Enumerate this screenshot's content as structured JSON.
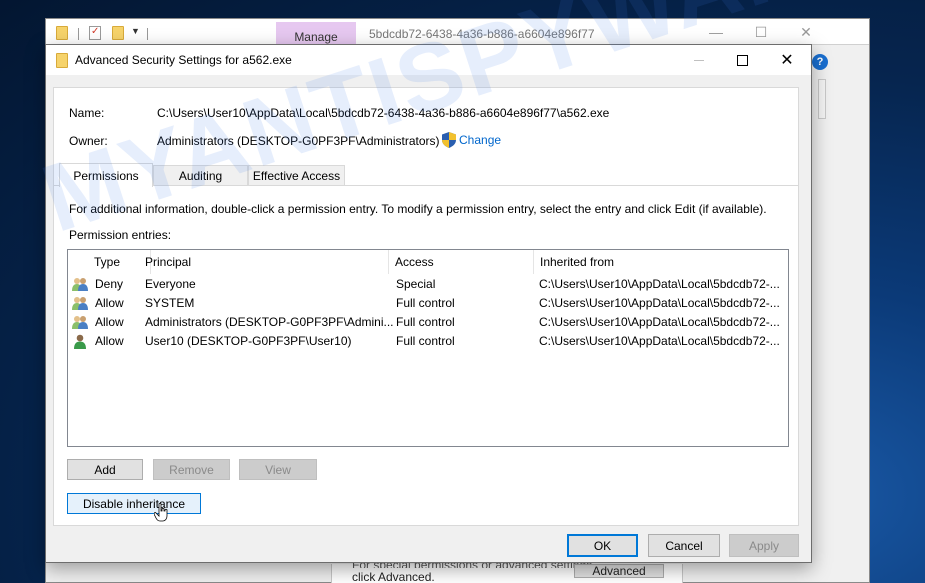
{
  "background_window": {
    "ribbon_tab": "Manage",
    "title": "5bdcdb72-6438-4a36-b886-a6604e896f77",
    "panel_text_partial": "For special permissions or advanced settings,",
    "panel_text": "click Advanced.",
    "advanced_button": "Advanced",
    "help_icon_glyph": "?"
  },
  "dialog": {
    "title": "Advanced Security Settings for a562.exe",
    "name_label": "Name:",
    "name_value": "C:\\Users\\User10\\AppData\\Local\\5bdcdb72-6438-4a36-b886-a6604e896f77\\a562.exe",
    "owner_label": "Owner:",
    "owner_value": "Administrators (DESKTOP-G0PF3PF\\Administrators)",
    "change_link": "Change",
    "tabs": [
      {
        "label": "Permissions",
        "active": true
      },
      {
        "label": "Auditing",
        "active": false
      },
      {
        "label": "Effective Access",
        "active": false
      }
    ],
    "info_text": "For additional information, double-click a permission entry. To modify a permission entry, select the entry and click Edit (if available).",
    "entries_label": "Permission entries:",
    "columns": [
      "Type",
      "Principal",
      "Access",
      "Inherited from"
    ],
    "entries": [
      {
        "icon": "group-icon",
        "type": "Deny",
        "principal": "Everyone",
        "access": "Special",
        "inherited_from": "C:\\Users\\User10\\AppData\\Local\\5bdcdb72-..."
      },
      {
        "icon": "group-icon",
        "type": "Allow",
        "principal": "SYSTEM",
        "access": "Full control",
        "inherited_from": "C:\\Users\\User10\\AppData\\Local\\5bdcdb72-..."
      },
      {
        "icon": "group-icon",
        "type": "Allow",
        "principal": "Administrators (DESKTOP-G0PF3PF\\Admini...",
        "access": "Full control",
        "inherited_from": "C:\\Users\\User10\\AppData\\Local\\5bdcdb72-..."
      },
      {
        "icon": "user-icon",
        "type": "Allow",
        "principal": "User10 (DESKTOP-G0PF3PF\\User10)",
        "access": "Full control",
        "inherited_from": "C:\\Users\\User10\\AppData\\Local\\5bdcdb72-..."
      }
    ],
    "buttons": {
      "add": "Add",
      "remove": "Remove",
      "view": "View",
      "disable_inheritance": "Disable inheritance",
      "ok": "OK",
      "cancel": "Cancel",
      "apply": "Apply"
    }
  },
  "watermark": "MYANTISPYWARE.COM",
  "colors": {
    "link": "#0066cc",
    "focus_border": "#0078d7",
    "manage_tab": "#e6c8f0"
  }
}
